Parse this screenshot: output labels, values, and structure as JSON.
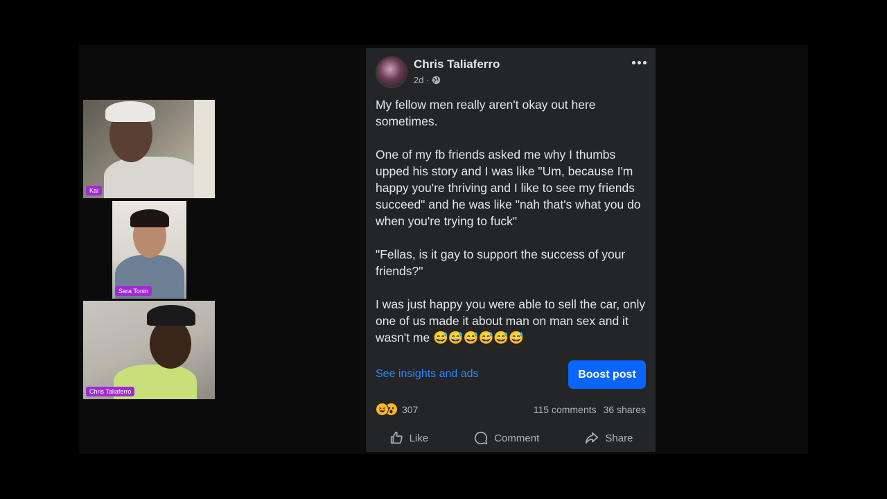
{
  "participants": [
    {
      "name": "Kai"
    },
    {
      "name": "Sara Tonin"
    },
    {
      "name": "Chris Taliaferro"
    }
  ],
  "post": {
    "author": "Chris Taliaferro",
    "time": "2d ·",
    "privacy_icon": "globe-icon",
    "more_icon": "more-horizontal-icon",
    "paragraphs": [
      "My fellow men really aren't okay out here sometimes.",
      "One of my fb friends asked me why I thumbs upped his story and I was like \"Um, because I'm happy you're thriving and I like to see my friends succeed\" and he was like \"nah that's what you do when you're trying to fuck\"",
      "\"Fellas, is it gay to support the success of your friends?\"",
      "I was just happy you were able to sell the car, only one of us made it about man on man sex and it wasn't me 😅😅😅😅😅😅"
    ],
    "insights_link": "See insights and ads",
    "boost_button": "Boost post",
    "reaction_icons": [
      "haha-reaction-icon",
      "wow-reaction-icon"
    ],
    "reaction_count": "307",
    "comments": "115 comments",
    "shares": "36 shares",
    "actions": {
      "like": "Like",
      "comment": "Comment",
      "share": "Share"
    }
  },
  "colors": {
    "background": "#000000",
    "card": "#242526",
    "primary_text": "#e4e6eb",
    "secondary_text": "#b0b3b8",
    "link": "#2d88ff",
    "boost": "#0866ff",
    "name_tag": "#a02bd6"
  }
}
